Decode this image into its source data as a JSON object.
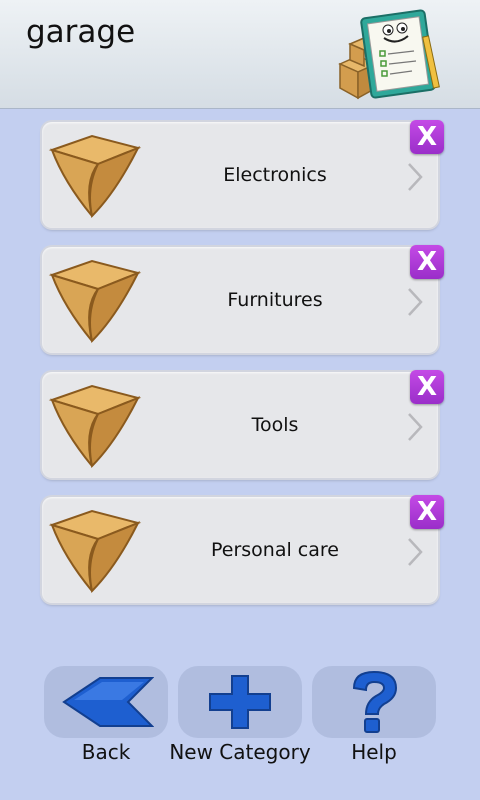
{
  "header": {
    "title": "garage",
    "mascot_icon": "clipboard-mascot-icon"
  },
  "categories": [
    {
      "label": "Electronics",
      "icon": "cardboard-box-icon",
      "delete_label": "X"
    },
    {
      "label": "Furnitures",
      "icon": "cardboard-box-icon",
      "delete_label": "X"
    },
    {
      "label": "Tools",
      "icon": "cardboard-box-icon",
      "delete_label": "X"
    },
    {
      "label": "Personal care",
      "icon": "cardboard-box-icon",
      "delete_label": "X"
    }
  ],
  "footer": {
    "back_label": "Back",
    "new_category_label": "New Category",
    "help_label": "Help"
  },
  "colors": {
    "background": "#c3cff0",
    "delete_button": "#b13fd9",
    "footer_icon": "#1e5fd0"
  }
}
